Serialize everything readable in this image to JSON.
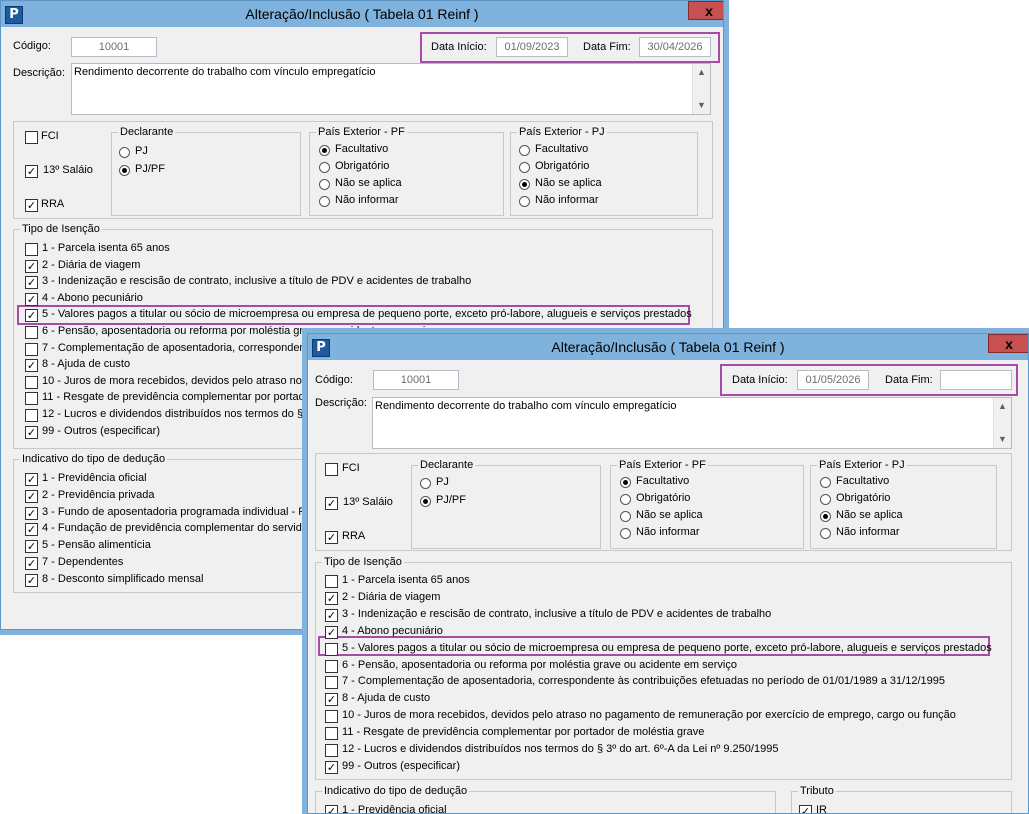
{
  "back": {
    "title": "Alteração/Inclusão ( Tabela 01 Reinf )",
    "icon_letter": "P",
    "close": "x",
    "codigo_label": "Código:",
    "codigo_value": "10001",
    "data_inicio_label": "Data Início:",
    "data_inicio_value": "01/09/2023",
    "data_fim_label": "Data Fim:",
    "data_fim_value": "30/04/2026",
    "descricao_label": "Descrição:",
    "descricao_value": "Rendimento decorrente do trabalho com vínculo empregatício",
    "fci": "FCI",
    "fci_checked": false,
    "decimo": "13º Saláio",
    "decimo_checked": true,
    "rra": "RRA",
    "rra_checked": true,
    "declarante": {
      "title": "Declarante",
      "options": [
        "PJ",
        "PJ/PF"
      ],
      "selected": 1
    },
    "pf": {
      "title": "País Exterior - PF",
      "options": [
        "Facultativo",
        "Obrigatório",
        "Não se aplica",
        "Não informar"
      ],
      "selected": 0
    },
    "pj": {
      "title": "País Exterior - PJ",
      "options": [
        "Facultativo",
        "Obrigatório",
        "Não se aplica",
        "Não informar"
      ],
      "selected": 2
    },
    "isencao_title": "Tipo de Isenção",
    "isencao": [
      {
        "label": "1 - Parcela isenta 65 anos",
        "checked": false
      },
      {
        "label": "2 - Diária de viagem",
        "checked": true
      },
      {
        "label": "3 - Indenização e rescisão de contrato, inclusive a título de PDV e acidentes de trabalho",
        "checked": true
      },
      {
        "label": "4 - Abono pecuniário",
        "checked": true
      },
      {
        "label": "5 - Valores pagos a titular ou sócio de microempresa ou empresa de pequeno porte, exceto pró-labore, alugueis e serviços prestados",
        "checked": true
      },
      {
        "label": "6 - Pensão, aposentadoria ou reforma por moléstia grave ou acidente em serviço",
        "checked": false
      },
      {
        "label": "7 - Complementação de aposentadoria, correspondente",
        "checked": false
      },
      {
        "label": "8 - Ajuda de custo",
        "checked": true
      },
      {
        "label": "10 - Juros de mora recebidos, devidos pelo atraso no p",
        "checked": false
      },
      {
        "label": "11 - Resgate de previdência complementar por portador",
        "checked": false
      },
      {
        "label": "12 - Lucros e dividendos distribuídos nos termos do § 3º",
        "checked": false
      },
      {
        "label": "99 - Outros (especificar)",
        "checked": true
      }
    ],
    "deducao_title": "Indicativo do tipo de dedução",
    "deducao": [
      {
        "label": "1 - Previdência oficial",
        "checked": true
      },
      {
        "label": "2 - Previdência privada",
        "checked": true
      },
      {
        "label": "3 - Fundo de aposentadoria programada individual - Fap",
        "checked": true
      },
      {
        "label": "4 - Fundação de previdência complementar do servidor",
        "checked": true
      },
      {
        "label": "5 - Pensão alimentícia",
        "checked": true
      },
      {
        "label": "7 - Dependentes",
        "checked": true
      },
      {
        "label": "8 - Desconto simplificado mensal",
        "checked": true
      }
    ]
  },
  "front": {
    "title": "Alteração/Inclusão ( Tabela 01 Reinf )",
    "icon_letter": "P",
    "close": "x",
    "codigo_label": "Código:",
    "codigo_value": "10001",
    "data_inicio_label": "Data Início:",
    "data_inicio_value": "01/05/2026",
    "data_fim_label": "Data Fim:",
    "data_fim_value": "",
    "descricao_label": "Descrição:",
    "descricao_value": "Rendimento decorrente do trabalho com vínculo empregatício",
    "fci": "FCI",
    "fci_checked": false,
    "decimo": "13º Saláio",
    "decimo_checked": true,
    "rra": "RRA",
    "rra_checked": true,
    "declarante": {
      "title": "Declarante",
      "options": [
        "PJ",
        "PJ/PF"
      ],
      "selected": 1
    },
    "pf": {
      "title": "País Exterior - PF",
      "options": [
        "Facultativo",
        "Obrigatório",
        "Não se aplica",
        "Não informar"
      ],
      "selected": 0
    },
    "pj": {
      "title": "País Exterior - PJ",
      "options": [
        "Facultativo",
        "Obrigatório",
        "Não se aplica",
        "Não informar"
      ],
      "selected": 2
    },
    "isencao_title": "Tipo de Isenção",
    "isencao": [
      {
        "label": "1 - Parcela isenta 65 anos",
        "checked": false
      },
      {
        "label": "2 - Diária de viagem",
        "checked": true
      },
      {
        "label": "3 - Indenização e rescisão de contrato, inclusive a título de PDV e acidentes de trabalho",
        "checked": true
      },
      {
        "label": "4 - Abono pecuniário",
        "checked": true
      },
      {
        "label": "5 - Valores pagos a titular ou sócio de microempresa ou empresa de pequeno porte, exceto pró-labore, alugueis e serviços prestados",
        "checked": false
      },
      {
        "label": "6 - Pensão, aposentadoria ou reforma por moléstia grave ou acidente em serviço",
        "checked": false
      },
      {
        "label": "7 - Complementação de aposentadoria, correspondente às contribuições efetuadas no período de 01/01/1989 a 31/12/1995",
        "checked": false
      },
      {
        "label": "8 - Ajuda de custo",
        "checked": true
      },
      {
        "label": "10 - Juros de mora recebidos, devidos pelo atraso no pagamento de remuneração por exercício de emprego, cargo ou função",
        "checked": false
      },
      {
        "label": "11 - Resgate de previdência complementar por portador de moléstia grave",
        "checked": false
      },
      {
        "label": "12 - Lucros e dividendos distribuídos nos termos do § 3º do art. 6º-A da Lei nº 9.250/1995",
        "checked": false
      },
      {
        "label": "99 - Outros (especificar)",
        "checked": true
      }
    ],
    "deducao_title": "Indicativo do tipo de dedução",
    "deducao": [
      {
        "label": "1 - Previdência oficial",
        "checked": true
      }
    ],
    "tributo_title": "Tributo",
    "tributo": [
      {
        "label": "IR",
        "checked": true
      }
    ]
  }
}
